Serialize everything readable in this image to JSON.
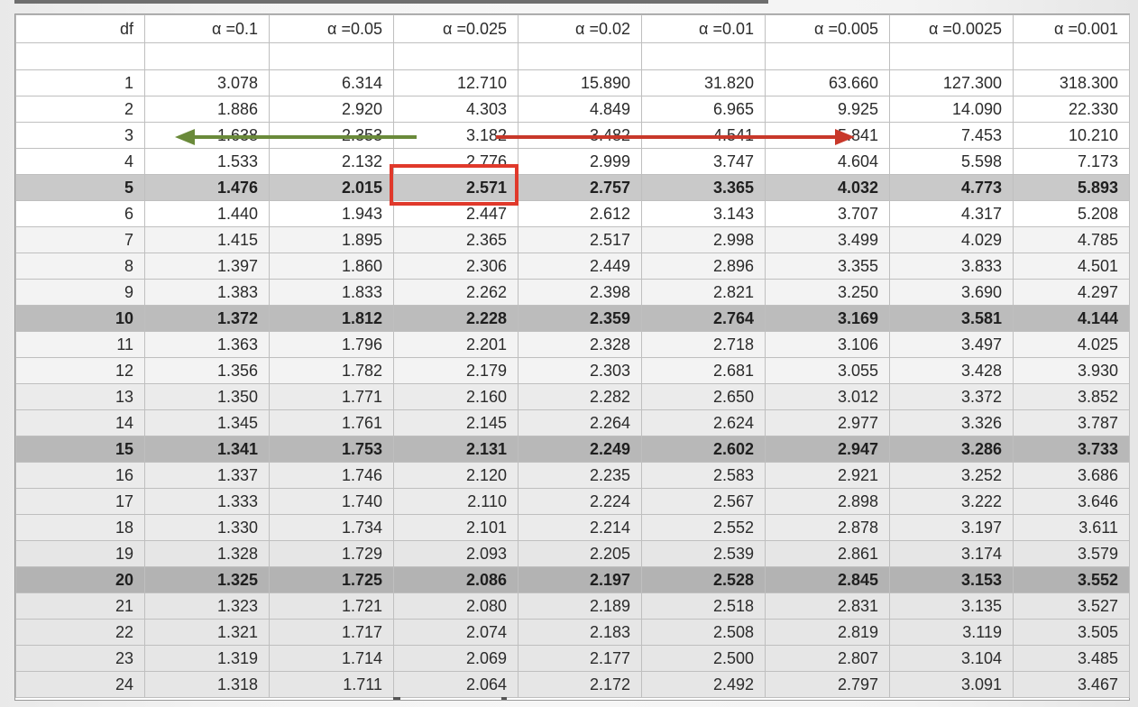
{
  "table": {
    "headers": [
      "df",
      "α =0.1",
      "α =0.05",
      "α =0.025",
      "α =0.02",
      "α =0.01",
      "α =0.005",
      "α =0.0025",
      "α =0.001"
    ],
    "rows": [
      [
        "1",
        "3.078",
        "6.314",
        "12.710",
        "15.890",
        "31.820",
        "63.660",
        "127.300",
        "318.300"
      ],
      [
        "2",
        "1.886",
        "2.920",
        "4.303",
        "4.849",
        "6.965",
        "9.925",
        "14.090",
        "22.330"
      ],
      [
        "3",
        "1.638",
        "2.353",
        "3.182",
        "3.482",
        "4.541",
        "5.841",
        "7.453",
        "10.210"
      ],
      [
        "4",
        "1.533",
        "2.132",
        "2.776",
        "2.999",
        "3.747",
        "4.604",
        "5.598",
        "7.173"
      ],
      [
        "5",
        "1.476",
        "2.015",
        "2.571",
        "2.757",
        "3.365",
        "4.032",
        "4.773",
        "5.893"
      ],
      [
        "6",
        "1.440",
        "1.943",
        "2.447",
        "2.612",
        "3.143",
        "3.707",
        "4.317",
        "5.208"
      ],
      [
        "7",
        "1.415",
        "1.895",
        "2.365",
        "2.517",
        "2.998",
        "3.499",
        "4.029",
        "4.785"
      ],
      [
        "8",
        "1.397",
        "1.860",
        "2.306",
        "2.449",
        "2.896",
        "3.355",
        "3.833",
        "4.501"
      ],
      [
        "9",
        "1.383",
        "1.833",
        "2.262",
        "2.398",
        "2.821",
        "3.250",
        "3.690",
        "4.297"
      ],
      [
        "10",
        "1.372",
        "1.812",
        "2.228",
        "2.359",
        "2.764",
        "3.169",
        "3.581",
        "4.144"
      ],
      [
        "11",
        "1.363",
        "1.796",
        "2.201",
        "2.328",
        "2.718",
        "3.106",
        "3.497",
        "4.025"
      ],
      [
        "12",
        "1.356",
        "1.782",
        "2.179",
        "2.303",
        "2.681",
        "3.055",
        "3.428",
        "3.930"
      ],
      [
        "13",
        "1.350",
        "1.771",
        "2.160",
        "2.282",
        "2.650",
        "3.012",
        "3.372",
        "3.852"
      ],
      [
        "14",
        "1.345",
        "1.761",
        "2.145",
        "2.264",
        "2.624",
        "2.977",
        "3.326",
        "3.787"
      ],
      [
        "15",
        "1.341",
        "1.753",
        "2.131",
        "2.249",
        "2.602",
        "2.947",
        "3.286",
        "3.733"
      ],
      [
        "16",
        "1.337",
        "1.746",
        "2.120",
        "2.235",
        "2.583",
        "2.921",
        "3.252",
        "3.686"
      ],
      [
        "17",
        "1.333",
        "1.740",
        "2.110",
        "2.224",
        "2.567",
        "2.898",
        "3.222",
        "3.646"
      ],
      [
        "18",
        "1.330",
        "1.734",
        "2.101",
        "2.214",
        "2.552",
        "2.878",
        "3.197",
        "3.611"
      ],
      [
        "19",
        "1.328",
        "1.729",
        "2.093",
        "2.205",
        "2.539",
        "2.861",
        "3.174",
        "3.579"
      ],
      [
        "20",
        "1.325",
        "1.725",
        "2.086",
        "2.197",
        "2.528",
        "2.845",
        "3.153",
        "3.552"
      ],
      [
        "21",
        "1.323",
        "1.721",
        "2.080",
        "2.189",
        "2.518",
        "2.831",
        "3.135",
        "3.527"
      ],
      [
        "22",
        "1.321",
        "1.717",
        "2.074",
        "2.183",
        "2.508",
        "2.819",
        "3.119",
        "3.505"
      ],
      [
        "23",
        "1.319",
        "1.714",
        "2.069",
        "2.177",
        "2.500",
        "2.807",
        "3.104",
        "3.485"
      ],
      [
        "24",
        "1.318",
        "1.711",
        "2.064",
        "2.172",
        "2.492",
        "2.797",
        "3.091",
        "3.467"
      ]
    ],
    "bold_rows": [
      "5",
      "10",
      "15",
      "20"
    ]
  },
  "annotations": {
    "highlight_cell": {
      "row": "5",
      "column": "α =0.025",
      "value": "2.571"
    },
    "green_arrow": {
      "direction": "left",
      "row": "3"
    },
    "red_arrow": {
      "direction": "right",
      "row": "3"
    },
    "colors": {
      "green_arrow": "#6a8a3a",
      "red_arrow": "#c8382a",
      "highlight_box": "#e0392b"
    }
  }
}
